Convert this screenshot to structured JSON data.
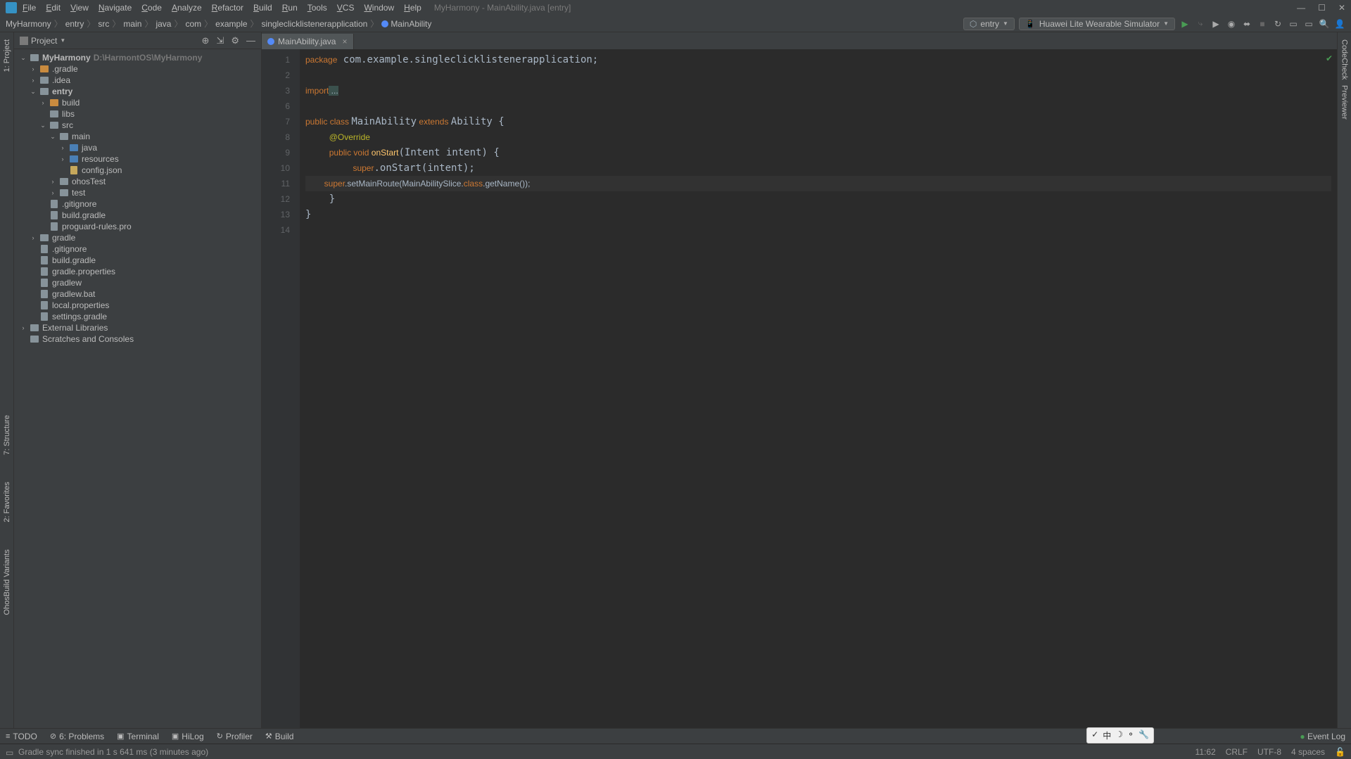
{
  "window": {
    "title": "MyHarmony - MainAbility.java [entry]"
  },
  "menu": [
    "File",
    "Edit",
    "View",
    "Navigate",
    "Code",
    "Analyze",
    "Refactor",
    "Build",
    "Run",
    "Tools",
    "VCS",
    "Window",
    "Help"
  ],
  "breadcrumbs": [
    "MyHarmony",
    "entry",
    "src",
    "main",
    "java",
    "com",
    "example",
    "singleclicklistenerapplication",
    "MainAbility"
  ],
  "runConfig": {
    "module": "entry",
    "device": "Huawei Lite Wearable Simulator"
  },
  "projectPanel": {
    "title": "Project",
    "root": {
      "label": "MyHarmony",
      "path": "D:\\HarmontOS\\MyHarmony"
    },
    "tree": [
      {
        "indent": 0,
        "chev": "v",
        "icon": "project",
        "label": "MyHarmony",
        "path": "D:\\HarmontOS\\MyHarmony",
        "bold": true
      },
      {
        "indent": 1,
        "chev": ">",
        "icon": "folder-orange",
        "label": ".gradle"
      },
      {
        "indent": 1,
        "chev": ">",
        "icon": "folder",
        "label": ".idea"
      },
      {
        "indent": 1,
        "chev": "v",
        "icon": "module",
        "label": "entry",
        "bold": true
      },
      {
        "indent": 2,
        "chev": ">",
        "icon": "folder-orange",
        "label": "build"
      },
      {
        "indent": 2,
        "chev": "",
        "icon": "folder",
        "label": "libs"
      },
      {
        "indent": 2,
        "chev": "v",
        "icon": "folder",
        "label": "src"
      },
      {
        "indent": 3,
        "chev": "v",
        "icon": "folder",
        "label": "main"
      },
      {
        "indent": 4,
        "chev": ">",
        "icon": "folder-blue",
        "label": "java"
      },
      {
        "indent": 4,
        "chev": ">",
        "icon": "folder-blue",
        "label": "resources"
      },
      {
        "indent": 4,
        "chev": "",
        "icon": "file-json",
        "label": "config.json"
      },
      {
        "indent": 3,
        "chev": ">",
        "icon": "folder",
        "label": "ohosTest"
      },
      {
        "indent": 3,
        "chev": ">",
        "icon": "folder",
        "label": "test"
      },
      {
        "indent": 2,
        "chev": "",
        "icon": "file",
        "label": ".gitignore"
      },
      {
        "indent": 2,
        "chev": "",
        "icon": "file",
        "label": "build.gradle"
      },
      {
        "indent": 2,
        "chev": "",
        "icon": "file",
        "label": "proguard-rules.pro"
      },
      {
        "indent": 1,
        "chev": ">",
        "icon": "folder",
        "label": "gradle"
      },
      {
        "indent": 1,
        "chev": "",
        "icon": "file",
        "label": ".gitignore"
      },
      {
        "indent": 1,
        "chev": "",
        "icon": "file",
        "label": "build.gradle"
      },
      {
        "indent": 1,
        "chev": "",
        "icon": "file",
        "label": "gradle.properties"
      },
      {
        "indent": 1,
        "chev": "",
        "icon": "file",
        "label": "gradlew"
      },
      {
        "indent": 1,
        "chev": "",
        "icon": "file",
        "label": "gradlew.bat"
      },
      {
        "indent": 1,
        "chev": "",
        "icon": "file",
        "label": "local.properties"
      },
      {
        "indent": 1,
        "chev": "",
        "icon": "file",
        "label": "settings.gradle"
      },
      {
        "indent": 0,
        "chev": ">",
        "icon": "lib",
        "label": "External Libraries"
      },
      {
        "indent": 0,
        "chev": "",
        "icon": "scratch",
        "label": "Scratches and Consoles"
      }
    ]
  },
  "leftGutter": [
    "1: Project"
  ],
  "leftGutterLower": [
    "7: Structure",
    "2: Favorites",
    "OhosBuild Variants"
  ],
  "rightGutter": [
    "CodeCheck",
    "Previewer"
  ],
  "editor": {
    "tab": "MainAbility.java",
    "lineNumbers": [
      1,
      2,
      3,
      6,
      7,
      8,
      9,
      10,
      11,
      12,
      13,
      14
    ],
    "code": {
      "l1": {
        "kw": "package",
        "rest": " com.example.singleclicklistenerapplication;"
      },
      "l3": {
        "kw": "import",
        "rest": " ..."
      },
      "l7a": {
        "kw1": "public class ",
        "cls": "MainAbility",
        "kw2": " extends ",
        "sup": "Ability",
        "rest": " {"
      },
      "l8": "@Override",
      "l9": {
        "kw1": "public void ",
        "fn": "onStart",
        "rest": "(Intent intent) {"
      },
      "l10": {
        "kw": "super",
        "rest": ".onStart(intent);"
      },
      "l11": {
        "kw1": "super",
        "rest1": ".setMainRoute(MainAbilitySlice.",
        "kw2": "class",
        "rest2": ".getName());"
      },
      "l12": "    }",
      "l13": "}"
    }
  },
  "bottomTabs": [
    {
      "icon": "≡",
      "label": "TODO"
    },
    {
      "icon": "⊘",
      "label": "6: Problems"
    },
    {
      "icon": "▣",
      "label": "Terminal"
    },
    {
      "icon": "▣",
      "label": "HiLog"
    },
    {
      "icon": "↻",
      "label": "Profiler"
    },
    {
      "icon": "⚒",
      "label": "Build"
    }
  ],
  "eventLog": "Event Log",
  "status": {
    "message": "Gradle sync finished in 1 s 641 ms (3 minutes ago)",
    "position": "11:62",
    "lineEnding": "CRLF",
    "encoding": "UTF-8",
    "indent": "4 spaces"
  },
  "ime": [
    "✓",
    "中",
    "☽",
    "⚬",
    "🔧"
  ]
}
